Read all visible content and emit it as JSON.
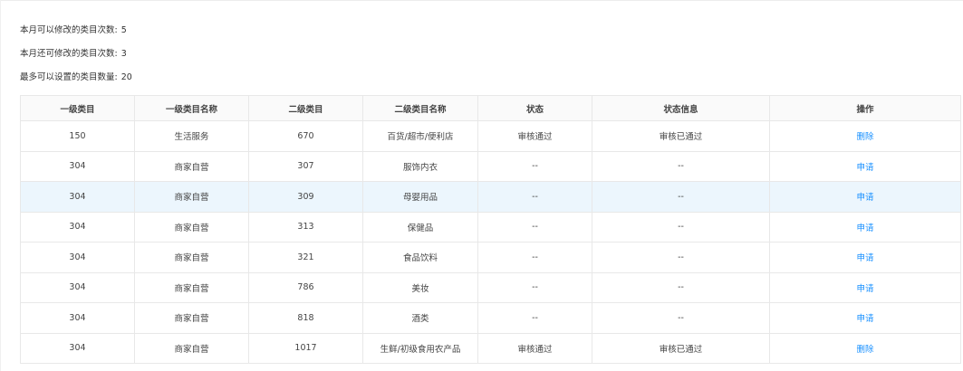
{
  "info": {
    "monthly_changes_label": "本月可以修改的类目次数:",
    "monthly_changes_value": "5",
    "remaining_changes_label": "本月还可修改的类目次数:",
    "remaining_changes_value": "3",
    "max_categories_label": "最多可以设置的类目数量:",
    "max_categories_value": "20"
  },
  "table": {
    "headers": [
      "一级类目",
      "一级类目名称",
      "二级类目",
      "二级类目名称",
      "状态",
      "状态信息",
      "操作"
    ],
    "rows": [
      {
        "l1_id": "150",
        "l1_name": "生活服务",
        "l2_id": "670",
        "l2_name": "百货/超市/便利店",
        "status": "审核通过",
        "status_info": "审核已通过",
        "action": "删除"
      },
      {
        "l1_id": "304",
        "l1_name": "商家自营",
        "l2_id": "307",
        "l2_name": "服饰内衣",
        "status": "--",
        "status_info": "--",
        "action": "申请"
      },
      {
        "l1_id": "304",
        "l1_name": "商家自营",
        "l2_id": "309",
        "l2_name": "母婴用品",
        "status": "--",
        "status_info": "--",
        "action": "申请"
      },
      {
        "l1_id": "304",
        "l1_name": "商家自营",
        "l2_id": "313",
        "l2_name": "保健品",
        "status": "--",
        "status_info": "--",
        "action": "申请"
      },
      {
        "l1_id": "304",
        "l1_name": "商家自营",
        "l2_id": "321",
        "l2_name": "食品饮料",
        "status": "--",
        "status_info": "--",
        "action": "申请"
      },
      {
        "l1_id": "304",
        "l1_name": "商家自营",
        "l2_id": "786",
        "l2_name": "美妆",
        "status": "--",
        "status_info": "--",
        "action": "申请"
      },
      {
        "l1_id": "304",
        "l1_name": "商家自营",
        "l2_id": "818",
        "l2_name": "酒类",
        "status": "--",
        "status_info": "--",
        "action": "申请"
      },
      {
        "l1_id": "304",
        "l1_name": "商家自营",
        "l2_id": "1017",
        "l2_name": "生鲜/初级食用农产品",
        "status": "审核通过",
        "status_info": "审核已通过",
        "action": "删除"
      }
    ]
  },
  "colors": {
    "link": "#1890ff",
    "highlight_row": "#ecf6fd",
    "header_bg": "#fafafa",
    "border": "#e8e8e8"
  }
}
